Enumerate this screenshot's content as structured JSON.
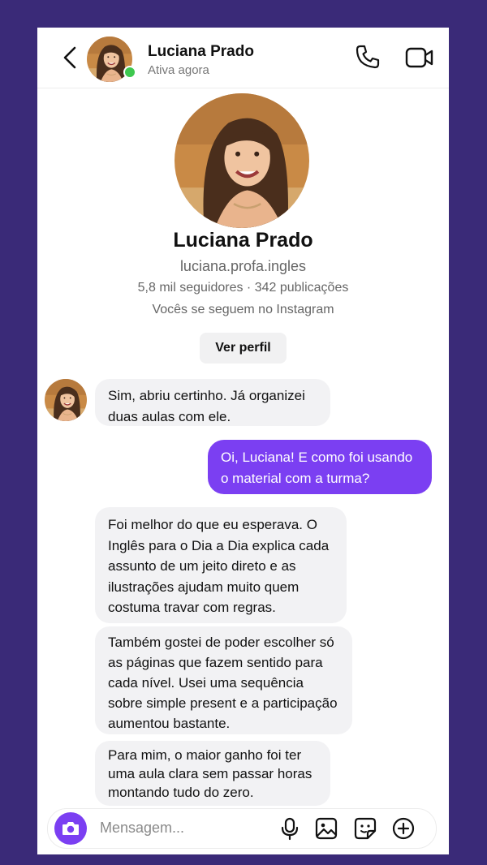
{
  "header": {
    "name": "Luciana Prado",
    "status": "Ativa agora"
  },
  "profile": {
    "name": "Luciana Prado",
    "username": "luciana.profa.ingles",
    "stats": "5,8 mil seguidores · 342 publicações",
    "mutual": "Vocês se seguem no Instagram",
    "button": "Ver perfil"
  },
  "messages": [
    {
      "side": "in",
      "text": "Sim, abriu certinho. Já organizei duas aulas com ele."
    },
    {
      "side": "out",
      "text": "Oi, Luciana! E como foi usando o material com a turma?"
    },
    {
      "side": "in",
      "text": "Foi melhor do que eu esperava. O Inglês para o Dia a Dia explica cada assunto de um jeito direto e as ilustrações ajudam muito quem costuma travar com regras."
    },
    {
      "side": "in",
      "text": "Também gostei de poder escolher só as páginas que fazem sentido para cada nível. Usei uma sequência sobre simple present e a participação aumentou bastante."
    },
    {
      "side": "in",
      "text": "Para mim, o maior ganho foi ter uma aula clara sem passar horas montando tudo do zero."
    }
  ],
  "composer": {
    "placeholder": "Mensagem..."
  },
  "colors": {
    "background": "#3a2a78",
    "accent": "#7b3ff2",
    "incoming_bubble": "#f2f2f4",
    "online": "#3ec84f"
  },
  "icons": [
    "back-arrow-icon",
    "phone-icon",
    "video-camera-icon",
    "camera-icon",
    "microphone-icon",
    "image-icon",
    "sticker-icon",
    "plus-circle-icon"
  ]
}
